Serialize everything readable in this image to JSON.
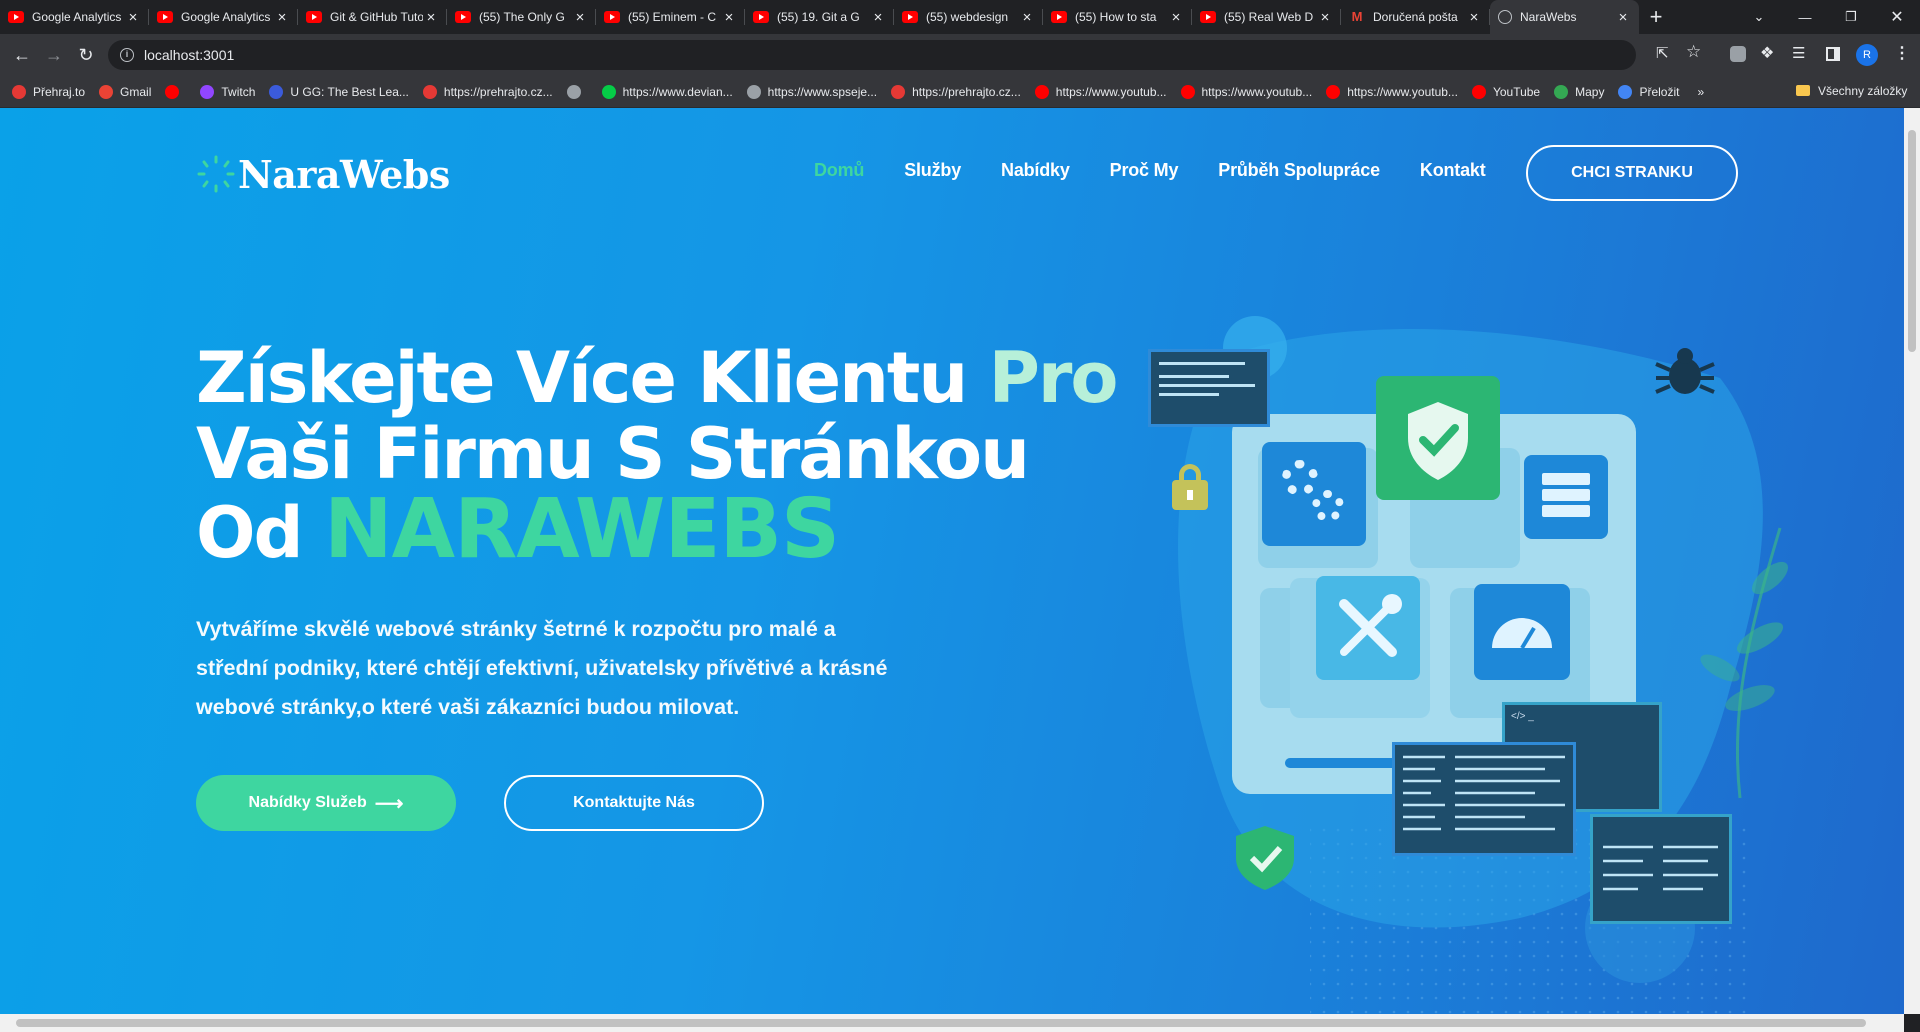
{
  "browser": {
    "tabs": [
      {
        "title": "Google Analytics",
        "icon": "youtube-icon"
      },
      {
        "title": "Google Analytics",
        "icon": "youtube-icon"
      },
      {
        "title": "Git & GitHub Tutorial",
        "icon": "youtube-icon"
      },
      {
        "title": "(55) The Only G",
        "icon": "youtube-icon"
      },
      {
        "title": "(55) Eminem - C",
        "icon": "youtube-icon"
      },
      {
        "title": "(55) 19. Git a G",
        "icon": "youtube-icon"
      },
      {
        "title": "(55) webdesign",
        "icon": "youtube-icon"
      },
      {
        "title": "(55) How to sta",
        "icon": "youtube-icon"
      },
      {
        "title": "(55) Real Web D",
        "icon": "youtube-icon"
      },
      {
        "title": "Doručená pošta",
        "icon": "gmail-icon"
      },
      {
        "title": "NaraWebs",
        "icon": "globe-icon",
        "active": true
      }
    ],
    "url": "localhost:3001",
    "profile_initial": "R",
    "bookmarks": [
      {
        "label": "Přehraj.to",
        "color": "#e53935"
      },
      {
        "label": "Gmail",
        "color": "#ea4335"
      },
      {
        "label": "",
        "color": "#ff0000"
      },
      {
        "label": "Twitch",
        "color": "#9146ff"
      },
      {
        "label": "U GG: The Best Lea...",
        "color": "#3b5bdb"
      },
      {
        "label": "https://prehrajto.cz...",
        "color": "#e53935"
      },
      {
        "label": "",
        "color": "#9aa0a6"
      },
      {
        "label": "https://www.devian...",
        "color": "#05cc47"
      },
      {
        "label": "https://www.spseje...",
        "color": "#9aa0a6"
      },
      {
        "label": "https://prehrajto.cz...",
        "color": "#e53935"
      },
      {
        "label": "https://www.youtub...",
        "color": "#ff0000"
      },
      {
        "label": "https://www.youtub...",
        "color": "#ff0000"
      },
      {
        "label": "https://www.youtub...",
        "color": "#ff0000"
      },
      {
        "label": "YouTube",
        "color": "#ff0000"
      },
      {
        "label": "Mapy",
        "color": "#34a853"
      },
      {
        "label": "Přeložit",
        "color": "#4285f4"
      }
    ],
    "bookmarks_more": "»",
    "all_bookmarks": "Všechny záložky"
  },
  "site": {
    "logo": "NaraWebs",
    "nav": [
      "Domů",
      "Služby",
      "Nabídky",
      "Proč My",
      "Průběh Spolupráce",
      "Kontakt"
    ],
    "cta": "CHCI STRANKU",
    "hero": {
      "line1_a": "Získejte Více Klientu ",
      "line1_b": "Pro",
      "line2": "Vaši Firmu S Stránkou",
      "line3_a": "Od ",
      "line3_b": "NARAWEBS",
      "description": "Vytváříme skvělé webové stránky šetrné k rozpočtu pro malé a střední podniky, které chtějí efektivní, uživatelsky přívětivé a krásné webové stránky,o které vaši zákazníci budou milovat.",
      "primary_button": "Nabídky Služeb",
      "primary_button_icon": "arrow-right-icon",
      "secondary_button": "Kontaktujte Nás"
    },
    "colors": {
      "accent": "#3ed6a0",
      "background": "#1596e6"
    }
  }
}
